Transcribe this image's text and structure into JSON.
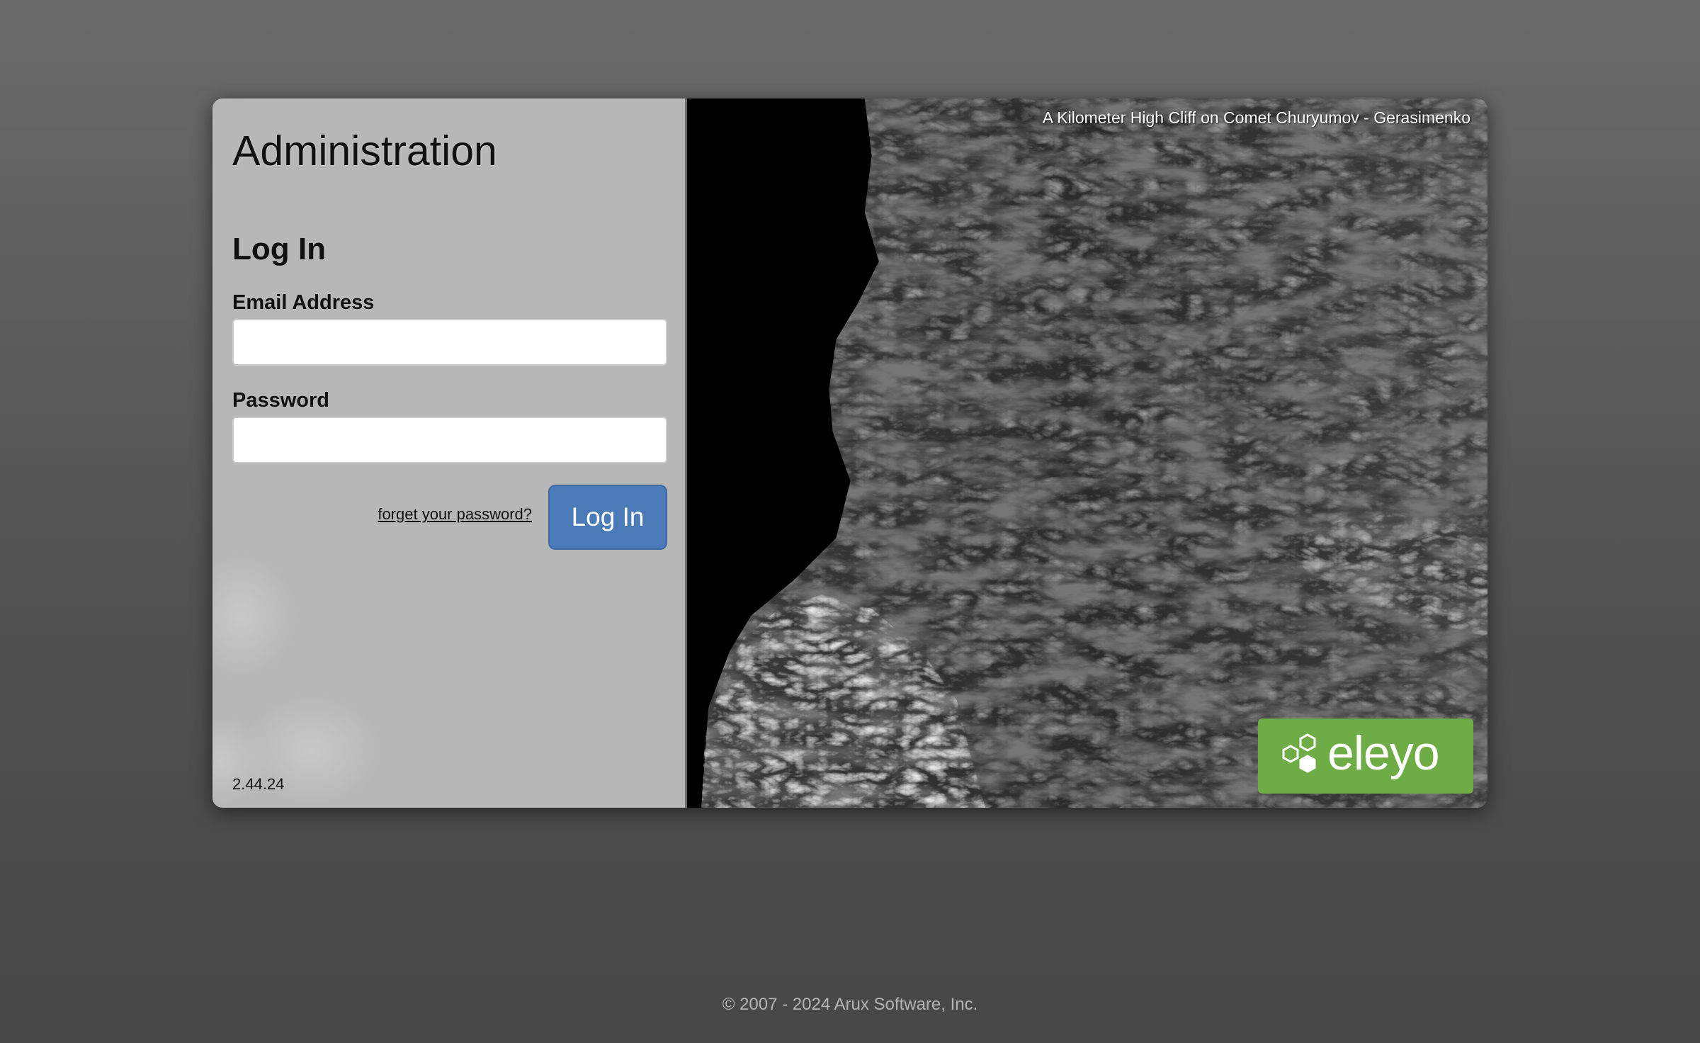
{
  "page": {
    "app_title": "Administration",
    "version": "2.44.24",
    "footer": "© 2007 - 2024 Arux Software, Inc."
  },
  "login": {
    "heading": "Log In",
    "email_label": "Email Address",
    "email_value": "",
    "password_label": "Password",
    "password_value": "",
    "forgot_label": "forget your password?",
    "submit_label": "Log In"
  },
  "photo": {
    "caption": "A Kilometer High Cliff on Comet Churyumov - Gerasimenko"
  },
  "brand": {
    "logo_text": "eleyo",
    "logo_icon": "hexagon-cluster-icon",
    "logo_color": "#6eac45",
    "button_color": "#4a7bb8"
  }
}
